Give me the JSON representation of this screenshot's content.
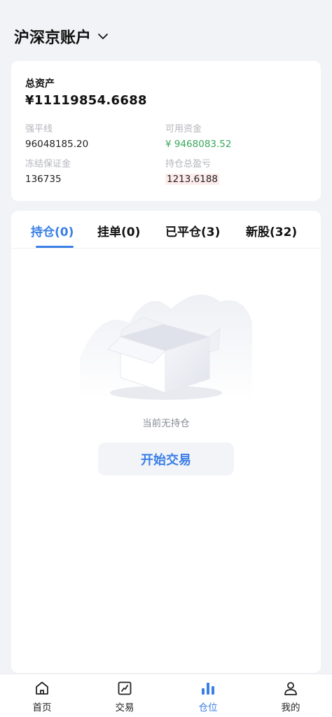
{
  "header": {
    "title": "沪深京账户",
    "dropdown_icon": "chevron-down-icon"
  },
  "assets": {
    "total_label": "总资产",
    "total_value": "¥11119854.6688",
    "liquidation_label": "强平线",
    "liquidation_value": "96048185.20",
    "available_label": "可用资金",
    "available_value": "¥ 9468083.52",
    "frozen_label": "冻结保证金",
    "frozen_value": "136735",
    "pnl_label": "持仓总盈亏",
    "pnl_value": "1213.6188"
  },
  "tabs": [
    {
      "label": "持仓(0)",
      "active": true
    },
    {
      "label": "挂单(0)",
      "active": false
    },
    {
      "label": "已平仓(3)",
      "active": false
    },
    {
      "label": "新股(32)",
      "active": false
    }
  ],
  "empty": {
    "message": "当前无持仓",
    "button_label": "开始交易"
  },
  "bottom_nav": [
    {
      "label": "首页",
      "icon": "home-icon",
      "active": false
    },
    {
      "label": "交易",
      "icon": "trade-chart-icon",
      "active": false
    },
    {
      "label": "仓位",
      "icon": "bar-chart-icon",
      "active": true
    },
    {
      "label": "我的",
      "icon": "user-icon",
      "active": false
    }
  ],
  "colors": {
    "accent": "#3a7fe6",
    "positive": "#3aa65b",
    "background": "#f2f3f7"
  }
}
